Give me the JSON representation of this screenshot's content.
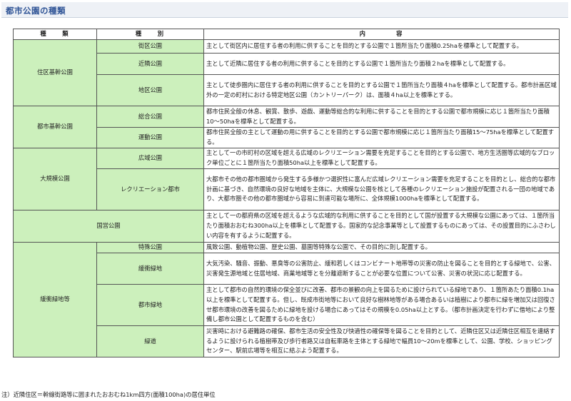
{
  "heading": "都市公園の種類",
  "table": {
    "headers": {
      "kind": "種　　類",
      "type": "種　　別",
      "content": "内　　　　容"
    },
    "groups": [
      {
        "name": "住区基幹公園",
        "rows": [
          {
            "type": "街区公園",
            "content": "主として街区内に居住する者の利用に供することを目的とする公園で１箇所当たり面積0.25haを標準として配置する。"
          },
          {
            "type": "近隣公園",
            "content": "主として近隣に居住する者の利用に供することを目的とする公園で１箇所当たり面積２haを標準として配置する。"
          },
          {
            "type": "地区公園",
            "content": "主として徒歩圏内に居住する者の利用に供することを目的とする公園で１箇所当たり面積４haを標準として配置する。都市計画区域外の一定の町村における特定地区公園（カントリーパーク）は、面積４ha以上を標準とする。"
          }
        ]
      },
      {
        "name": "都市基幹公園",
        "rows": [
          {
            "type": "総合公園",
            "content": "都市住民全般の休息、観賞、散歩、遊戯、運動等総合的な利用に供することを目的とする公園で都市規模に応じ１箇所当たり面積10～50haを標準として配置する。"
          },
          {
            "type": "運動公園",
            "content": "都市住民全般の主として運動の用に供することを目的とする公園で都市規模に応じ１箇所当たり面積15～75haを標準として配置する。"
          }
        ]
      },
      {
        "name": "大規模公園",
        "rows": [
          {
            "type": "広域公園",
            "content": "主として一の市町村の区域を超える広域のレクリエーション需要を充足することを目的とする公園で、地方生活圏等広域的なブロック単位ごとに１箇所当たり面積50ha以上を標準として配置する。"
          },
          {
            "type": "レクリエーション都市",
            "content": "大都市その他の都市圏域から発生する多様かつ選択性に富んだ広域レクリエーション需要を充足することを目的とし、総合的な都市計画に基づき、自然環境の良好な地域を主体に、大規模な公園を核として各種のレクリエーション施設が配置される一団の地域であり、大都市圏その他の都市圏域から容易に到達可能な場所に、全体規模1000haを標準として配置する。"
          }
        ]
      },
      {
        "name": "国営公園",
        "content": "主として一の都府県の区域を超えるような広域的な利用に供することを目的として国が設置する大規模な公園にあっては、１箇所当たり面積おおむね300ha以上を標準として配置する。国家的な記念事業等として設置するものにあっては、その設置目的にふさわしい内容を有するように配置する。"
      },
      {
        "name": "緩衝緑地等",
        "rows": [
          {
            "type": "特殊公園",
            "content": "風致公園、動植物公園、歴史公園、墓園等特殊な公園で、その目的に則し配置する。"
          },
          {
            "type": "緩衝緑地",
            "content": "大気汚染、騒音、振動、悪臭等の公害防止、緩和若しくはコンビナート地帯等の災害の防止を図ることを目的とする緑地で、公害、災害発生源地域と住居地域、商業地域等とを分離遮断することが必要な位置について公害、災害の状況に応じ配置する。"
          },
          {
            "type": "都市緑地",
            "content": "主として都市の自然的環境の保全並びに改善、都市の景観の向上を図るために設けられている緑地であり、１箇所あたり面積0.1ha以上を標準として配置する。但し、既成市街地等において良好な樹林地等がある場合あるいは植樹により都市に緑を増加又は回復させ都市環境の改善を図るために緑地を設ける場合にあってはその規模を0.05ha以上とする。（都市計画決定を行わずに借地により整備し都市公園として配置するものを含む）"
          },
          {
            "type": "緑道",
            "content": "災害時における避難路の確保、都市生活の安全性及び快適性の確保等を図ることを目的として、近隣住区又は近隣住区相互を連絡するように設けられる植樹帯及び歩行者路又は自転車路を主体とする緑地で幅員10～20mを標準として、公園、学校、ショッピングセンター、駅前広場等を相互に結ぶよう配置する。"
          }
        ]
      }
    ]
  },
  "note": "注）近隣住区＝幹線街路等に囲まれたおおむね1km四方(面積100ha)の居住単位"
}
